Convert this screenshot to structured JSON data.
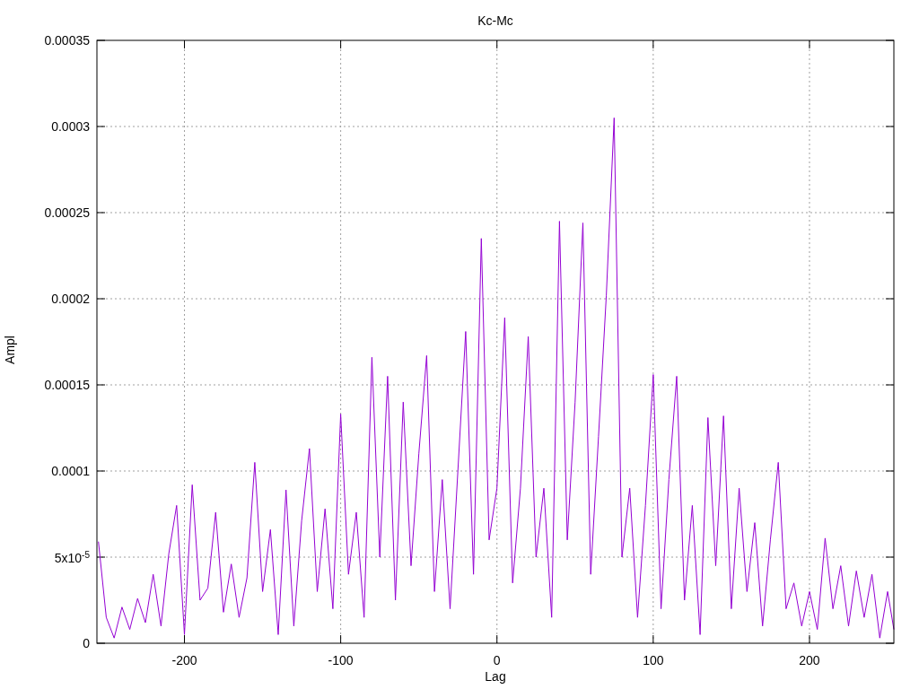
{
  "chart_data": {
    "type": "line",
    "title": "Kc-Mc",
    "xlabel": "Lag",
    "ylabel": "Ampl",
    "grid": true,
    "xlim": [
      -256,
      254
    ],
    "ylim": [
      0,
      0.00035
    ],
    "xticks": [
      -200,
      -100,
      0,
      100,
      200
    ],
    "yticks": [
      {
        "value": 0,
        "label": "0"
      },
      {
        "value": 5e-05,
        "label": "5x10$^{-5}$"
      },
      {
        "value": 0.0001,
        "label": "0.0001"
      },
      {
        "value": 0.00015,
        "label": "0.00015"
      },
      {
        "value": 0.0002,
        "label": "0.0002"
      },
      {
        "value": 0.00025,
        "label": "0.00025"
      },
      {
        "value": 0.0003,
        "label": "0.0003"
      },
      {
        "value": 0.00035,
        "label": "0.00035"
      }
    ],
    "x": [
      -255,
      -250,
      -245,
      -240,
      -235,
      -230,
      -225,
      -220,
      -215,
      -210,
      -205,
      -200,
      -195,
      -190,
      -185,
      -180,
      -175,
      -170,
      -165,
      -160,
      -155,
      -150,
      -145,
      -140,
      -135,
      -130,
      -125,
      -120,
      -115,
      -110,
      -105,
      -100,
      -95,
      -90,
      -85,
      -80,
      -75,
      -70,
      -65,
      -60,
      -55,
      -50,
      -45,
      -40,
      -35,
      -30,
      -25,
      -20,
      -15,
      -10,
      -5,
      0,
      5,
      10,
      15,
      20,
      25,
      30,
      35,
      40,
      45,
      50,
      55,
      60,
      65,
      70,
      75,
      80,
      85,
      90,
      95,
      100,
      105,
      110,
      115,
      120,
      125,
      130,
      135,
      140,
      145,
      150,
      155,
      160,
      165,
      170,
      175,
      180,
      185,
      190,
      195,
      200,
      205,
      210,
      215,
      220,
      225,
      230,
      235,
      240,
      245,
      250,
      254
    ],
    "series": [
      {
        "color": "#9400d3",
        "values": [
          5.9e-05,
          1.5e-05,
          3e-06,
          2.1e-05,
          8e-06,
          2.6e-05,
          1.2e-05,
          4e-05,
          1e-05,
          5.2e-05,
          8e-05,
          5e-06,
          9.2e-05,
          2.5e-05,
          3.2e-05,
          7.6e-05,
          1.8e-05,
          4.6e-05,
          1.5e-05,
          3.8e-05,
          0.000105,
          3e-05,
          6.6e-05,
          5e-06,
          8.9e-05,
          1e-05,
          7.1e-05,
          0.000113,
          3e-05,
          7.8e-05,
          2e-05,
          0.000133,
          4e-05,
          7.6e-05,
          1.5e-05,
          0.000166,
          5e-05,
          0.000155,
          2.5e-05,
          0.00014,
          4.5e-05,
          0.00011,
          0.000167,
          3e-05,
          9.5e-05,
          2e-05,
          0.0001,
          0.000181,
          4e-05,
          0.000235,
          6e-05,
          9e-05,
          0.000189,
          3.5e-05,
          9e-05,
          0.000178,
          5e-05,
          9e-05,
          1.5e-05,
          0.000245,
          6e-05,
          0.00014,
          0.000244,
          4e-05,
          0.00012,
          0.000202,
          0.000305,
          5e-05,
          9e-05,
          1.5e-05,
          8e-05,
          0.000156,
          2e-05,
          9.5e-05,
          0.000155,
          2.5e-05,
          8e-05,
          5e-06,
          0.000131,
          4.5e-05,
          0.000132,
          2e-05,
          9e-05,
          3e-05,
          7e-05,
          1e-05,
          6e-05,
          0.000105,
          2e-05,
          3.5e-05,
          1e-05,
          3e-05,
          8e-06,
          6.1e-05,
          2e-05,
          4.5e-05,
          1e-05,
          4.2e-05,
          1.5e-05,
          4e-05,
          3e-06,
          3e-05,
          8e-06
        ]
      }
    ]
  }
}
